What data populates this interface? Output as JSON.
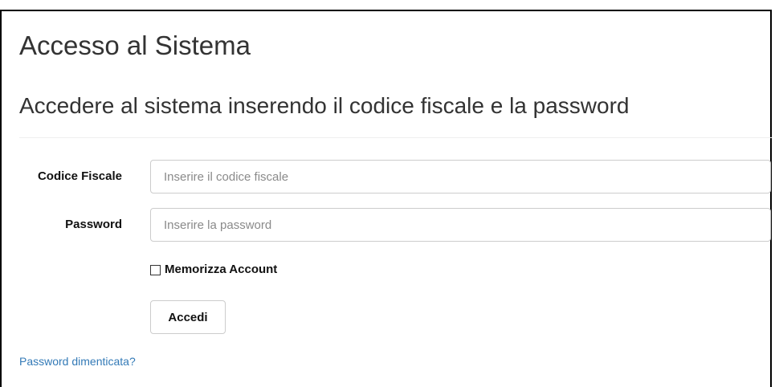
{
  "page": {
    "title": "Accesso al Sistema",
    "subtitle": "Accedere al sistema inserendo il codice fiscale e la password"
  },
  "form": {
    "codice_fiscale": {
      "label": "Codice Fiscale",
      "value": "",
      "placeholder": "Inserire il codice fiscale"
    },
    "password": {
      "label": "Password",
      "value": "",
      "placeholder": "Inserire la password"
    },
    "remember": {
      "label": "Memorizza Account",
      "checked": false
    },
    "submit_label": "Accedi",
    "forgot_link": "Password dimenticata?"
  },
  "colors": {
    "link": "#337ab7",
    "text": "#333333",
    "border": "#cccccc"
  }
}
